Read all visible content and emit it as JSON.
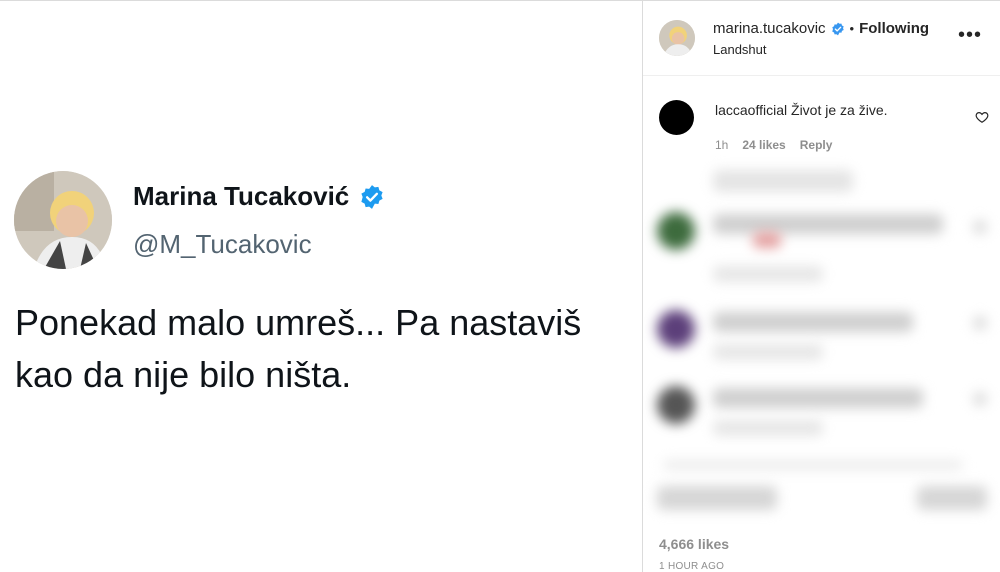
{
  "tweet": {
    "name": "Marina Tucaković",
    "handle": "@M_Tucakovic",
    "text": "Ponekad malo umreš... Pa nastaviš kao da nije bilo ništa."
  },
  "post_header": {
    "username": "marina.tucakovic",
    "separator": "•",
    "following_label": "Following",
    "location": "Landshut",
    "more_icon": "more-horizontal-icon"
  },
  "comment": {
    "username": "laccaofficial",
    "text": "Život je za žive.",
    "time": "1h",
    "likes": "24 likes",
    "reply_label": "Reply"
  },
  "footer": {
    "likes": "4,666 likes",
    "time": "1 HOUR AGO"
  },
  "colors": {
    "verified": "#1d9bf0",
    "ig_verified": "#3897f0",
    "text": "#262626",
    "muted": "#8e8e8e"
  }
}
